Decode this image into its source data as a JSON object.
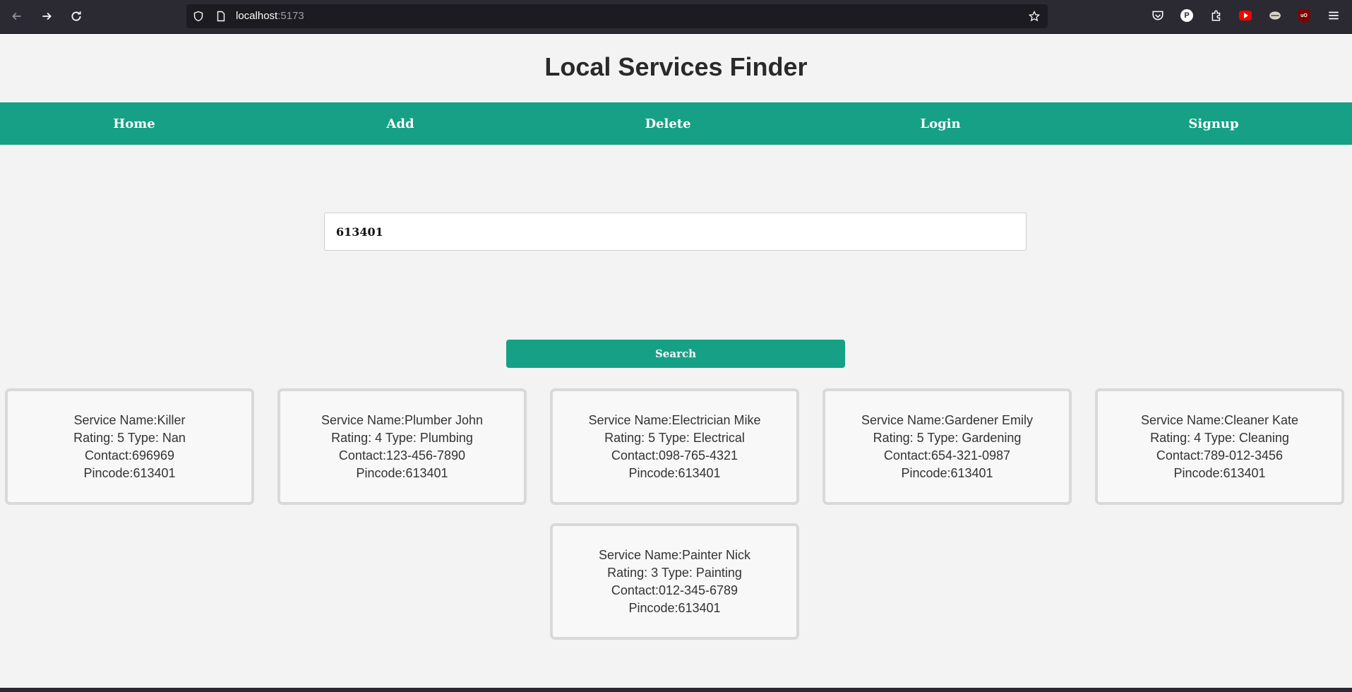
{
  "browser": {
    "url_host": "localhost",
    "url_port": ":5173"
  },
  "page": {
    "title": "Local Services Finder"
  },
  "nav": {
    "items": [
      "Home",
      "Add",
      "Delete",
      "Login",
      "Signup"
    ]
  },
  "search": {
    "value": "613401",
    "button_label": "Search"
  },
  "services": [
    {
      "name": "Service Name:Killer",
      "rating_type": "Rating: 5 Type: Nan",
      "contact": "Contact:696969",
      "pincode": "Pincode:613401"
    },
    {
      "name": "Service Name:Plumber John",
      "rating_type": "Rating: 4 Type: Plumbing",
      "contact": "Contact:123-456-7890",
      "pincode": "Pincode:613401"
    },
    {
      "name": "Service Name:Electrician Mike",
      "rating_type": "Rating: 5 Type: Electrical",
      "contact": "Contact:098-765-4321",
      "pincode": "Pincode:613401"
    },
    {
      "name": "Service Name:Gardener Emily",
      "rating_type": "Rating: 5 Type: Gardening",
      "contact": "Contact:654-321-0987",
      "pincode": "Pincode:613401"
    },
    {
      "name": "Service Name:Cleaner Kate",
      "rating_type": "Rating: 4 Type: Cleaning",
      "contact": "Contact:789-012-3456",
      "pincode": "Pincode:613401"
    },
    {
      "name": "Service Name:Painter Nick",
      "rating_type": "Rating: 3 Type: Painting",
      "contact": "Contact:012-345-6789",
      "pincode": "Pincode:613401"
    }
  ],
  "colors": {
    "accent": "#16a085",
    "chrome": "#2b2a33",
    "background": "#f3f3f3"
  }
}
